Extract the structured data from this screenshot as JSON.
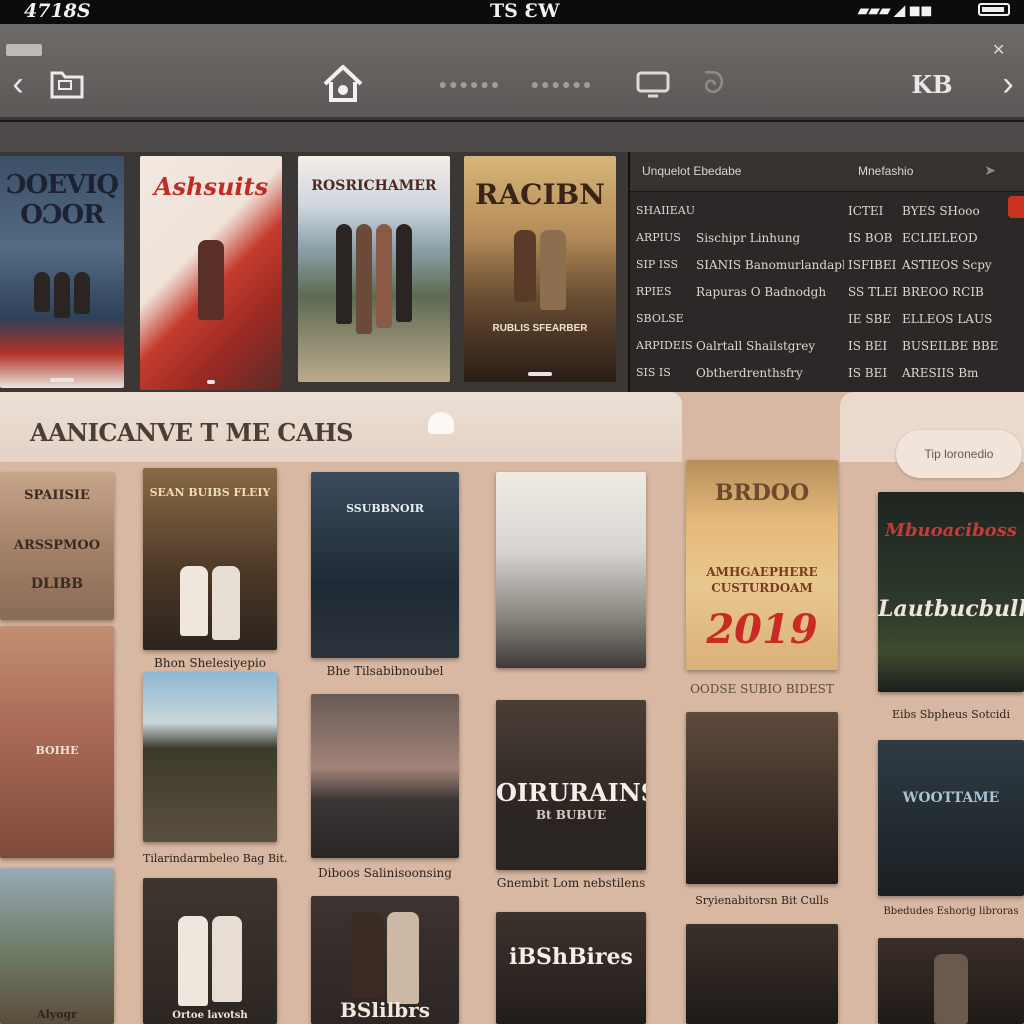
{
  "status_bar": {
    "time": "4718S",
    "carrier": "TS ƐW"
  },
  "top_posters": [
    {
      "title": "ƆOEVIQ OƆOR",
      "accent": "#b23327"
    },
    {
      "title": "Ashsuits",
      "accent": "#c22a26"
    },
    {
      "title": "ROSRICHAMER",
      "accent": "#4d2a20"
    },
    {
      "title": "RACIBN",
      "accent": "#3a2418",
      "footer": "RUBLIS SFEARBER"
    }
  ],
  "info_panel": {
    "header_left": "Unquelot Ebedabe",
    "header_right": "Mnefashio",
    "rows": [
      {
        "c1": "SHAIIEAUSS",
        "c2": "",
        "c3": "ICTEI",
        "c4": "BYES SHooo"
      },
      {
        "c1": "ARPIUS",
        "c2": "Sischipr Linhung",
        "c3": "IS BOB",
        "c4": "ECLIELEOD"
      },
      {
        "c1": "SIP ISS",
        "c2": "SIANIS Banomurlandaphy",
        "c3": "ISFIBEI",
        "c4": "ASTIEOS Scpy"
      },
      {
        "c1": "RPIES",
        "c2": "Rapuras O Badnodgh",
        "c3": "SS TLEI",
        "c4": "BREOO RCIB"
      },
      {
        "c1": "SBOLSE",
        "c2": "",
        "c3": "IE SBE",
        "c4": "ELLEOS LAUS"
      },
      {
        "c1": "ARPIDEIS",
        "c2": "Oalrtall Shailstgrey",
        "c3": "IS BEI",
        "c4": "BUSEILBE BBE"
      },
      {
        "c1": "SIS IS",
        "c2": "Obtherdrenthsfry",
        "c3": "IS BEI",
        "c4": "ARESIIS Bm"
      }
    ]
  },
  "lower_panel": {
    "title": "AANICANVE T ME CAHS",
    "pill_label": "Tip loronedio"
  },
  "tiles": {
    "col0": [
      "SPAIISIE",
      "ARSSPMOO",
      "DLIBB",
      "BOIHE",
      "Alyogr"
    ],
    "col1": {
      "t1": "SEAN BUIBS FLEIY",
      "cap1": "Bhon Shelesiyepio",
      "cap2": "Tilarindarmbeleo Bag Bit.",
      "cap3": "Ortoe lavotsh"
    },
    "col2": {
      "t1": "SSUBBNOIR",
      "cap1": "Bhe Tilsabibnoubel",
      "cap2": "Diboos Salinisoonsing",
      "t3": "BSlilbrs"
    },
    "col3": {
      "t2": "OIRURAINS",
      "t2sub": "Bt BUBUE",
      "cap1": "Gnembit Lom nebstilens",
      "t3": "iBShBires"
    },
    "col4": {
      "t1": "BRDOO",
      "t1b": "AMHGAEPHERE CUSTURDOAM",
      "year": "2019",
      "cap1": "OODSE SUBIO BIDEST",
      "cap2": "Sryienabitorsn Bit Culls"
    },
    "col5": {
      "t1": "Mbuoaciboss",
      "t1b": "Lautbucbulk",
      "cap1": "Eibs Sbpheus Sotcidi",
      "cap2": "Bbedudes Eshorig libroras",
      "t2": "WOOTTAME"
    }
  },
  "colors": {
    "background": "#d8b8a2",
    "toolbar": "#6e6b69",
    "info_panel": "#2b2827",
    "accent": "#c8341f"
  },
  "icons": [
    "chevron-left-icon",
    "folder-icon",
    "home-icon",
    "screen-icon",
    "swirl-icon",
    "library-icon",
    "chevron-right-icon",
    "battery-icon",
    "bulb-icon"
  ]
}
